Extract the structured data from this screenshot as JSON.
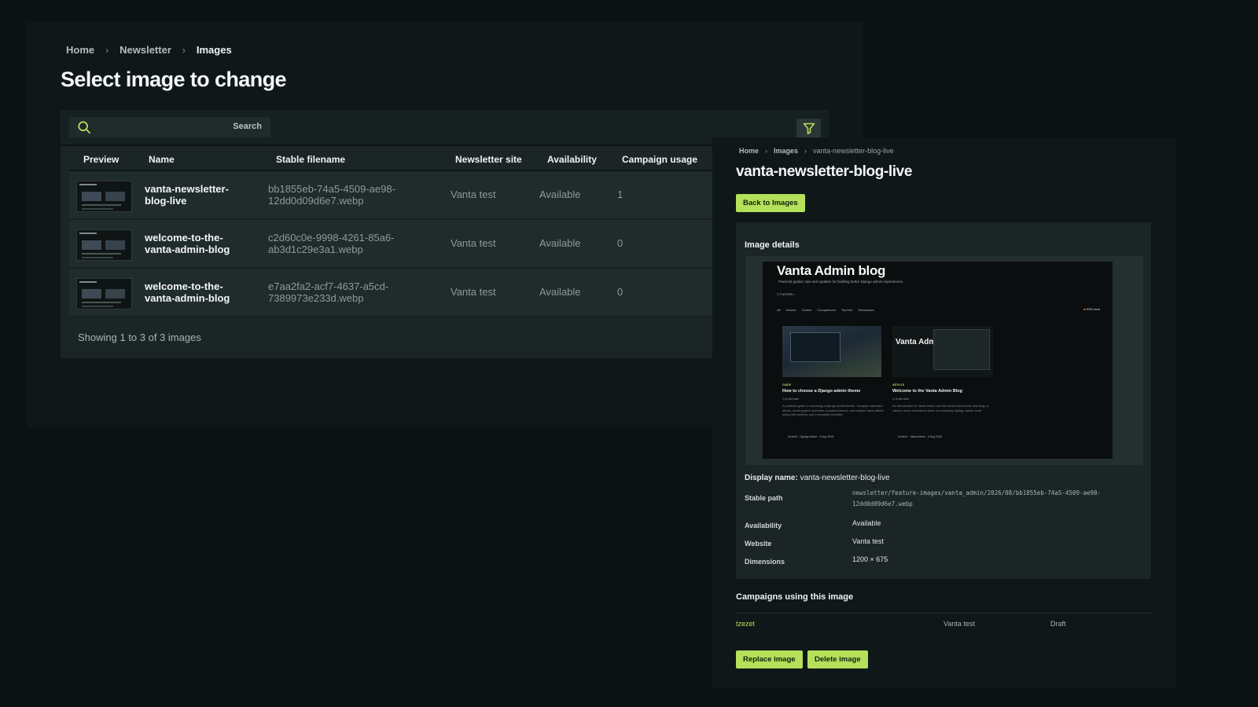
{
  "list": {
    "breadcrumb": [
      "Home",
      "Newsletter",
      "Images"
    ],
    "title": "Select image to change",
    "search_label": "Search",
    "columns": {
      "preview": "Preview",
      "name": "Name",
      "filename": "Stable filename",
      "site": "Newsletter site",
      "availability": "Availability",
      "usage": "Campaign usage"
    },
    "rows": [
      {
        "name": "vanta-newsletter-blog-live",
        "filename": "bb1855eb-74a5-4509-ae98-12dd0d09d6e7.webp",
        "site": "Vanta test",
        "availability": "Available",
        "usage": "1"
      },
      {
        "name": "welcome-to-the-vanta-admin-blog",
        "filename": "c2d60c0e-9998-4261-85a6-ab3d1c29e3a1.webp",
        "site": "Vanta test",
        "availability": "Available",
        "usage": "0"
      },
      {
        "name": "welcome-to-the-vanta-admin-blog",
        "filename": "e7aa2fa2-acf7-4637-a5cd-7389973e233d.webp",
        "site": "Vanta test",
        "availability": "Available",
        "usage": "0"
      }
    ],
    "count_text": "Showing 1 to 3 of 3 images"
  },
  "detail": {
    "breadcrumb": [
      "Home",
      "Images",
      "vanta-newsletter-blog-live"
    ],
    "title": "vanta-newsletter-blog-live",
    "back_label": "Back to Images",
    "card_heading": "Image details",
    "preview": {
      "title": "Vanta Admin blog",
      "subtitle": "Practical guides, tips and updates for building better Django admin experiences.",
      "filters": "FILTERS",
      "nav": [
        "All",
        "Articles",
        "Guides",
        "Comparisons",
        "Top lists",
        "Showcases"
      ],
      "rss": "RSS feed",
      "card1": {
        "tag": "GUIDE",
        "heading": "How to choose a Django admin theme",
        "meta": "8 min read",
        "desc": "A practical guide to choosing a Django admin theme. Compare standard admin, small project overrides, focused themes, and custom back offices using real screens and a reusable checklist.",
        "footer": "oli-dev0 · Django Admin · 4 Aug 2026"
      },
      "card2": {
        "tag": "ARTICLE",
        "image_text": "Vanta Admin",
        "heading": "Welcome to the Vanta Admin Blog",
        "meta": "3 min read",
        "desc": "An introduction to Vanta Admin and the ideas behind this new blog: a calmer, more considered place for everyday Django admin work.",
        "footer": "oli-dev0 · Vanta Admin · 4 Aug 2026"
      }
    },
    "display_name_label": "Display name:",
    "display_name_value": "vanta-newsletter-blog-live",
    "fields": {
      "stable_path_label": "Stable path",
      "stable_path_value": "newsletter/feature-images/vanta_admin/2026/08/bb1855eb-74a5-4509-ae98-12dd0d09d6e7.webp",
      "availability_label": "Availability",
      "availability_value": "Available",
      "website_label": "Website",
      "website_value": "Vanta test",
      "dimensions_label": "Dimensions",
      "dimensions_value": "1200 × 675"
    },
    "campaigns_heading": "Campaigns using this image",
    "campaign": {
      "name": "tzezet",
      "site": "Vanta test",
      "status": "Draft"
    },
    "replace_label": "Replace image",
    "delete_label": "Delete image"
  },
  "colors": {
    "accent": "#b4e05a",
    "background": "#0c1213",
    "card": "#1b2526"
  },
  "icons": [
    "search-icon",
    "filter-icon",
    "chevron-right-icon"
  ]
}
